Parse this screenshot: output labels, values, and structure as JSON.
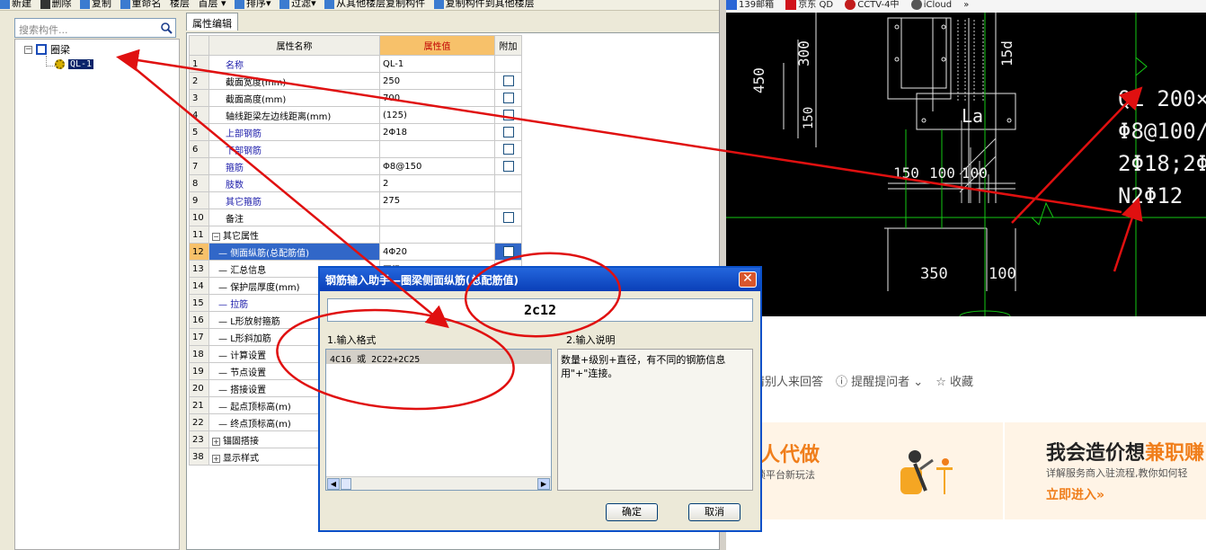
{
  "toolbar": {
    "items": [
      "新建",
      "删除",
      "复制",
      "重命名",
      "楼层",
      "首层",
      "排序",
      "过滤",
      "从其他楼层复制构件",
      "复制构件到其他楼层"
    ]
  },
  "search": {
    "placeholder": "搜索构件..."
  },
  "tree": {
    "root_label": "圈梁",
    "child_label": "QL-1"
  },
  "props": {
    "tab": "属性编辑",
    "headers": [
      "属性名称",
      "属性值",
      "附加"
    ],
    "rows": [
      {
        "num": "1",
        "name": "名称",
        "value": "QL-1",
        "blue": true,
        "check": false
      },
      {
        "num": "2",
        "name": "截面宽度(mm)",
        "value": "250",
        "blue": false,
        "check": true
      },
      {
        "num": "3",
        "name": "截面高度(mm)",
        "value": "700",
        "blue": false,
        "check": true
      },
      {
        "num": "4",
        "name": "轴线距梁左边线距离(mm)",
        "value": "(125)",
        "blue": false,
        "check": true
      },
      {
        "num": "5",
        "name": "上部钢筋",
        "value": "2Φ18",
        "blue": true,
        "check": true
      },
      {
        "num": "6",
        "name": "下部钢筋",
        "value": "",
        "blue": true,
        "check": true
      },
      {
        "num": "7",
        "name": "箍筋",
        "value": "Φ8@150",
        "blue": true,
        "check": true
      },
      {
        "num": "8",
        "name": "肢数",
        "value": "2",
        "blue": true,
        "check": false
      },
      {
        "num": "9",
        "name": "其它箍筋",
        "value": "275",
        "blue": true,
        "check": false
      },
      {
        "num": "10",
        "name": "备注",
        "value": "",
        "blue": false,
        "check": true
      },
      {
        "num": "11",
        "name": "其它属性",
        "value": "",
        "blue": false,
        "check": false,
        "group": true
      },
      {
        "num": "12",
        "name": "侧面纵筋(总配筋值)",
        "value": "4Φ20",
        "blue": false,
        "check": true,
        "highlight": true
      },
      {
        "num": "13",
        "name": "汇总信息",
        "value": "圈梁",
        "blue": false,
        "check": false
      },
      {
        "num": "14",
        "name": "保护层厚度(mm)",
        "value": "",
        "blue": false,
        "check": false
      },
      {
        "num": "15",
        "name": "拉筋",
        "value": "",
        "blue": true,
        "check": false
      },
      {
        "num": "16",
        "name": "L形放射箍筋",
        "value": "",
        "blue": false,
        "check": false
      },
      {
        "num": "17",
        "name": "L形斜加筋",
        "value": "",
        "blue": false,
        "check": false
      },
      {
        "num": "18",
        "name": "计算设置",
        "value": "",
        "blue": false,
        "check": false
      },
      {
        "num": "19",
        "name": "节点设置",
        "value": "",
        "blue": false,
        "check": false
      },
      {
        "num": "20",
        "name": "搭接设置",
        "value": "",
        "blue": false,
        "check": false
      },
      {
        "num": "21",
        "name": "起点顶标高(m)",
        "value": "",
        "blue": false,
        "check": false
      },
      {
        "num": "22",
        "name": "终点顶标高(m)",
        "value": "",
        "blue": false,
        "check": false
      },
      {
        "num": "23",
        "name": "锚固搭接",
        "value": "",
        "blue": false,
        "check": false,
        "group": true
      },
      {
        "num": "38",
        "name": "显示样式",
        "value": "",
        "blue": false,
        "check": false,
        "group": true
      }
    ]
  },
  "dialog": {
    "title": "钢筋输入助手—圈梁侧面纵筋(总配筋值)",
    "input_value": "2c12",
    "format_label": "1.输入格式",
    "desc_label": "2.输入说明",
    "format_item": "4C16 或 2C22+2C25",
    "description": "数量+级别+直径，有不同的钢筋信息用\"+\"连接。",
    "ok": "确定",
    "cancel": "取消"
  },
  "browser": {
    "bookmarks": [
      "139邮箱",
      "京东 QD",
      "CCTV-4中",
      "iCloud",
      "»"
    ]
  },
  "cad": {
    "texts": [
      "450",
      "300",
      "150",
      "15d",
      "La",
      "150",
      "100",
      "100",
      "350",
      "100",
      "QL 200×",
      "Φ8@100/",
      "2Φ18;2Φ2",
      "N2Φ12"
    ]
  },
  "web": {
    "qa": [
      "请别人来回答",
      "提醒提问者",
      "收藏"
    ],
    "banner_left_title": "找人代做",
    "banner_left_sub": "解锁平台新玩法",
    "banner_right_title_a": "我会造价想",
    "banner_right_title_b": "兼职赚",
    "banner_right_sub": "详解服务商入驻流程,教你如何轻",
    "banner_right_cta": "立即进入»"
  },
  "colors": {
    "annotation": "#e01010",
    "titlebar": "#0a4fd0",
    "accent": "#f07e1b"
  }
}
